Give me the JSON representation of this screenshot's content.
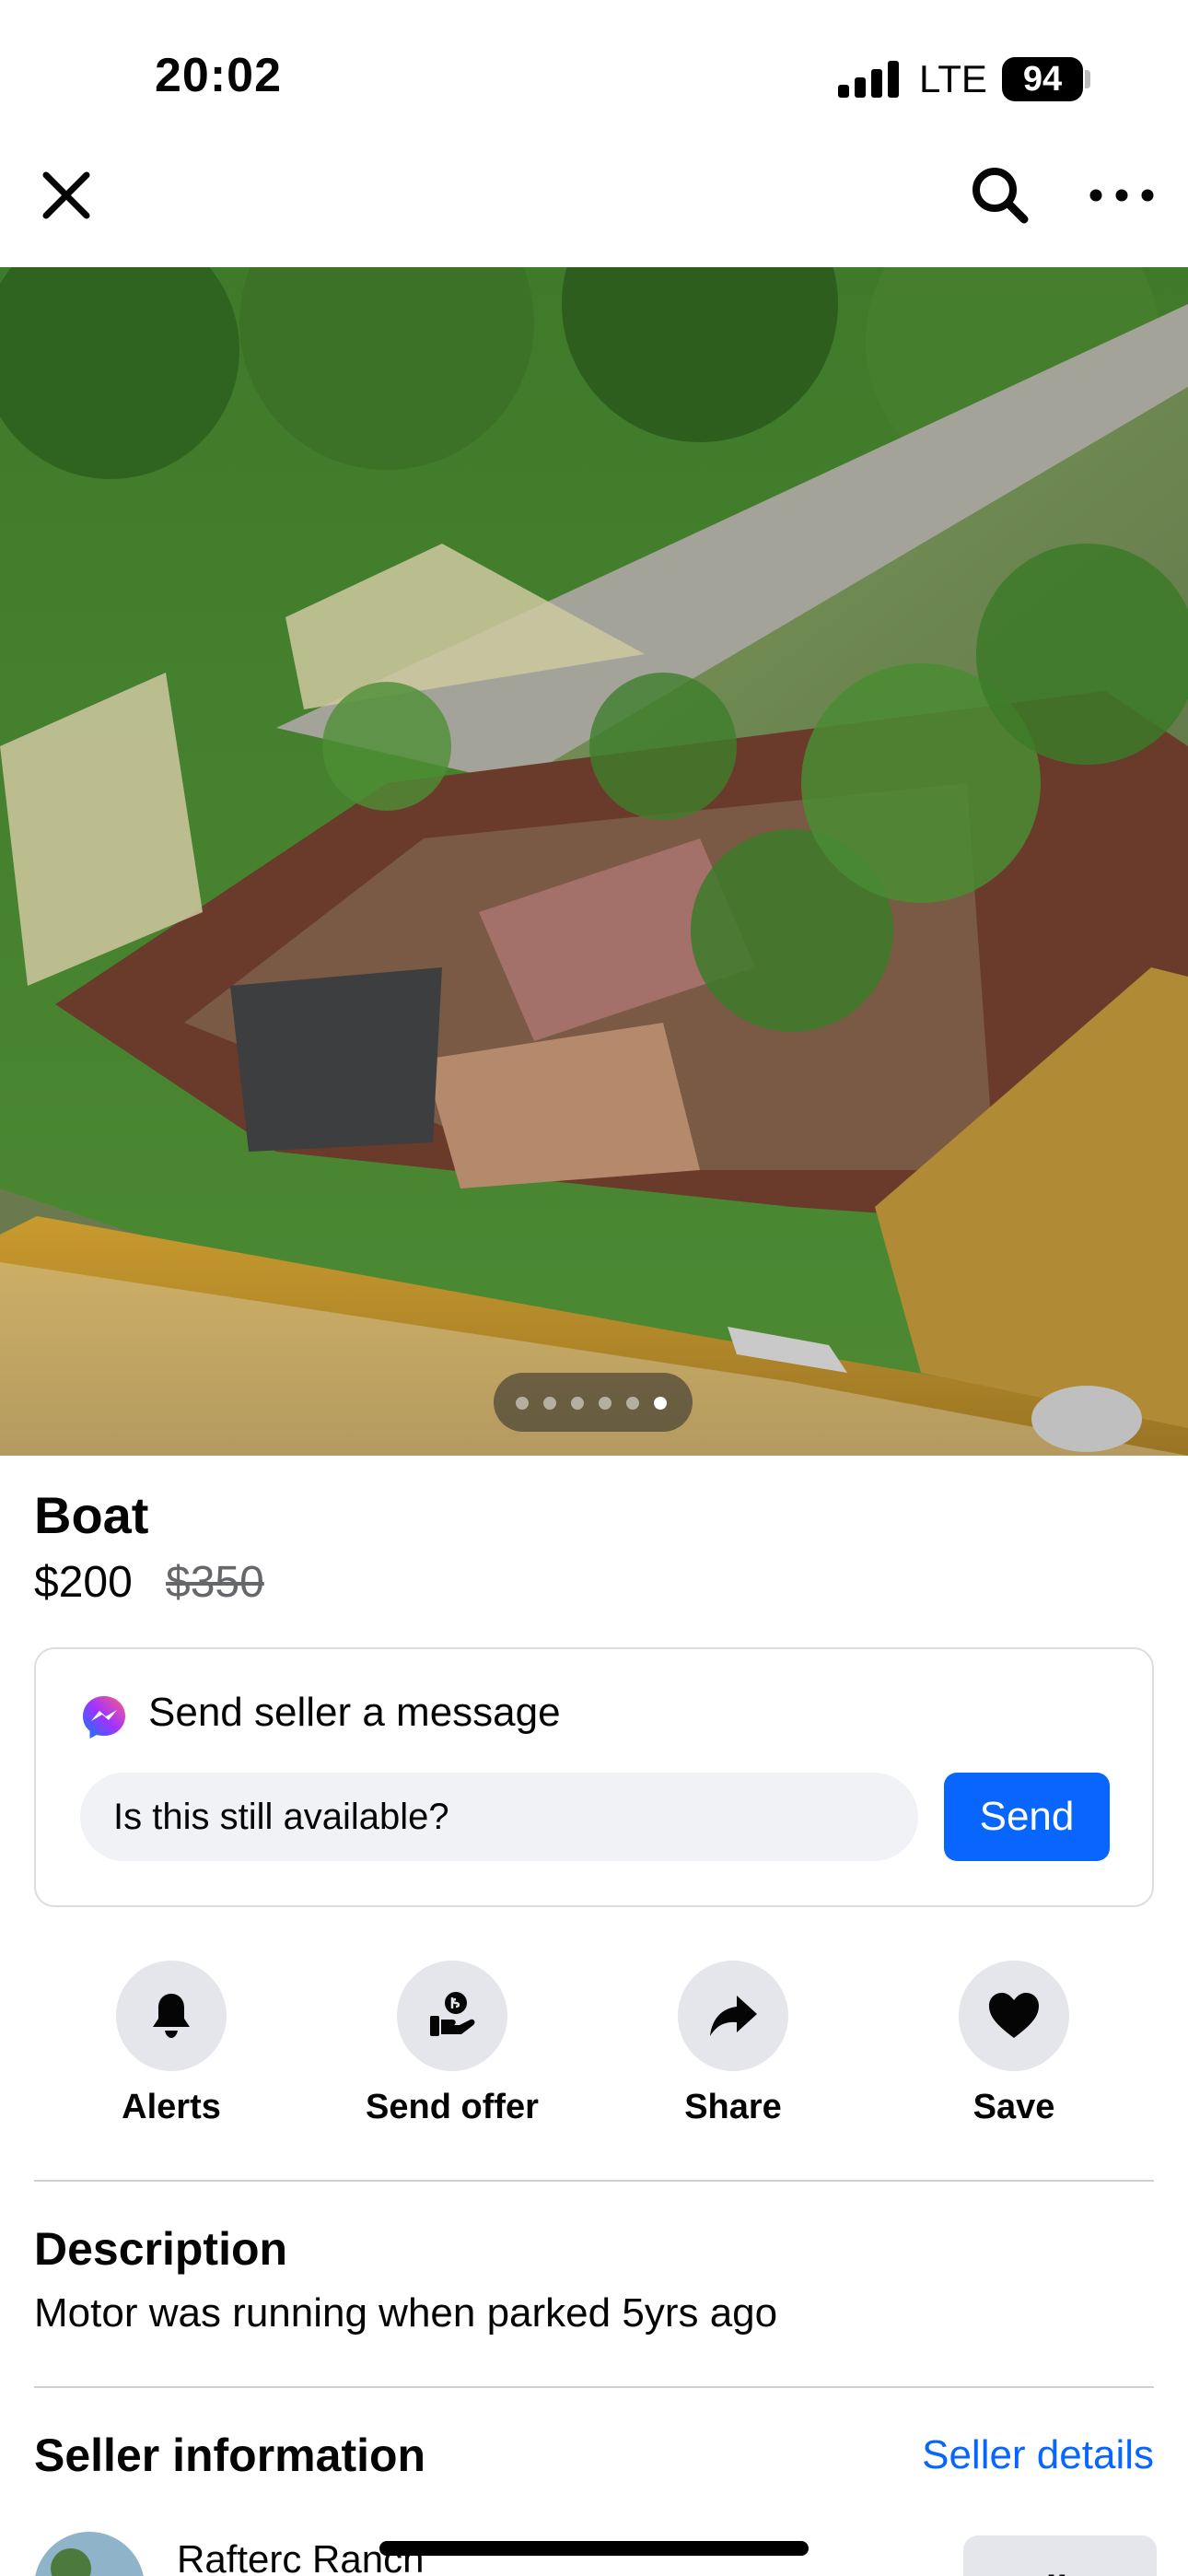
{
  "status_bar": {
    "time": "20:02",
    "network": "LTE",
    "battery": "94"
  },
  "nav": {
    "close_icon": "close-icon",
    "search_icon": "search-icon",
    "more_icon": "more-icon"
  },
  "photo": {
    "description_icon": "listing-photo",
    "carousel_count": 6,
    "carousel_active": 6
  },
  "listing": {
    "title": "Boat",
    "price": "$200",
    "original_price": "$350"
  },
  "message": {
    "title": "Send seller a message",
    "input_value": "Is this still available?",
    "send_label": "Send"
  },
  "actions": [
    {
      "label": "Alerts",
      "icon": "bell-icon"
    },
    {
      "label": "Send offer",
      "icon": "offer-icon"
    },
    {
      "label": "Share",
      "icon": "share-icon"
    },
    {
      "label": "Save",
      "icon": "heart-icon"
    }
  ],
  "description": {
    "heading": "Description",
    "text": "Motor was running when parked 5yrs ago"
  },
  "seller": {
    "heading": "Seller information",
    "details_link": "Seller details",
    "name": "Rafterc Ranch",
    "follow_label": "Follow"
  },
  "colors": {
    "accent": "#0866ff",
    "action_bg": "#e4e6eb",
    "input_bg": "#f0f2f5",
    "muted_text": "#65676b"
  }
}
